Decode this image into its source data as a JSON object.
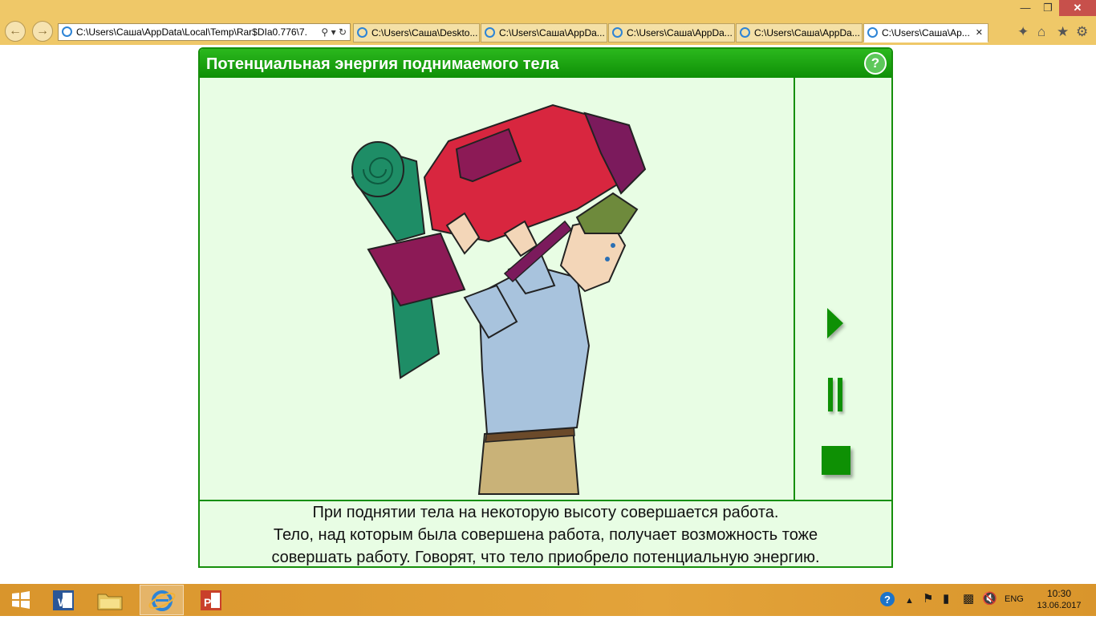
{
  "browser": {
    "address": "C:\\Users\\Саша\\AppData\\Local\\Temp\\Rar$DIa0.776\\7.",
    "tabs": [
      {
        "label": "C:\\Users\\Саша\\Deskto...",
        "active": false
      },
      {
        "label": "C:\\Users\\Саша\\AppDa...",
        "active": false
      },
      {
        "label": "C:\\Users\\Саша\\AppDa...",
        "active": false
      },
      {
        "label": "C:\\Users\\Саша\\AppDa...",
        "active": false
      },
      {
        "label": "C:\\Users\\Саша\\Ap...",
        "active": true
      }
    ],
    "accent": "#efc868"
  },
  "lesson": {
    "title": "Потенциальная энергия поднимаемого тела",
    "help_label": "?",
    "caption": [
      "При поднятии тела на некоторую высоту совершается работа.",
      "Тело, над которым была совершена работа,  получает возможность тоже",
      "совершать  работу.  Говорят, что тело приобрело потенциальную энергию."
    ],
    "colors": {
      "green": "#0e9004",
      "background": "#e8fde4"
    },
    "controls": [
      "play-icon",
      "pause-icon",
      "stop-icon"
    ]
  },
  "taskbar": {
    "apps": [
      "windows-start-icon",
      "word-icon",
      "file-explorer-icon",
      "internet-explorer-icon",
      "powerpoint-icon"
    ],
    "language": "ENG",
    "time": "10:30",
    "date": "13.06.2017"
  }
}
